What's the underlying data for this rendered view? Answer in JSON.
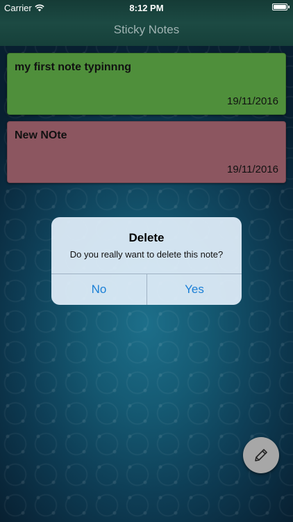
{
  "status_bar": {
    "carrier": "Carrier",
    "time": "8:12 PM"
  },
  "nav": {
    "title": "Sticky Notes"
  },
  "notes": [
    {
      "text": "my first note typinnng",
      "date": "19/11/2016",
      "color": "#4f8f3b"
    },
    {
      "text": "New NOte",
      "date": "19/11/2016",
      "color": "#8c5660"
    }
  ],
  "alert": {
    "title": "Delete",
    "message": "Do you really want to delete this note?",
    "cancel_label": "No",
    "confirm_label": "Yes",
    "button_color": "#1a7fd6"
  },
  "fab": {
    "icon": "pencil-icon"
  }
}
